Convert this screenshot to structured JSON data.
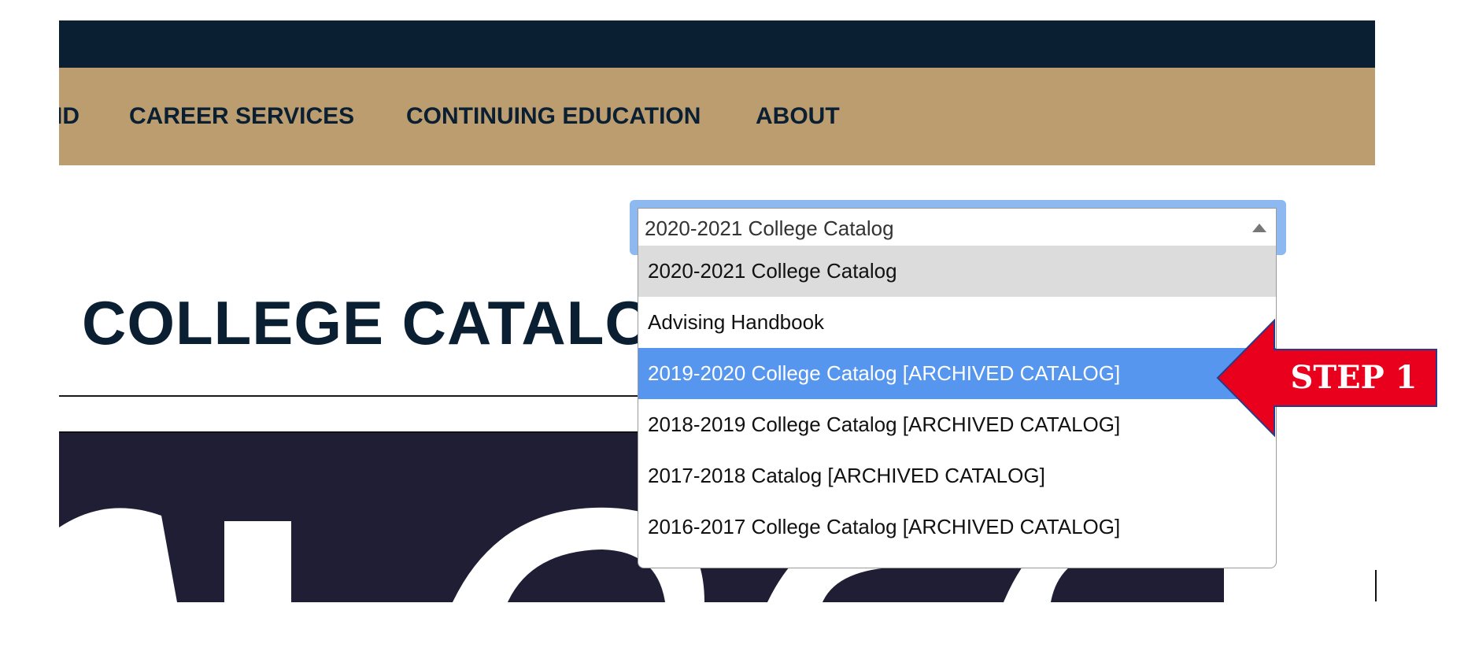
{
  "nav": {
    "items": [
      {
        "label": "ID"
      },
      {
        "label": "CAREER SERVICES"
      },
      {
        "label": "CONTINUING EDUCATION"
      },
      {
        "label": "ABOUT"
      }
    ]
  },
  "main": {
    "title": "COLLEGE CATALOG"
  },
  "catalog_select": {
    "selected": "2020-2021 College Catalog",
    "options": [
      {
        "label": "2020-2021 College Catalog",
        "state": "current"
      },
      {
        "label": "Advising Handbook",
        "state": "normal"
      },
      {
        "label": "2019-2020 College Catalog [ARCHIVED CATALOG]",
        "state": "highlighted"
      },
      {
        "label": "2018-2019 College Catalog [ARCHIVED CATALOG]",
        "state": "normal"
      },
      {
        "label": "2017-2018 Catalog [ARCHIVED CATALOG]",
        "state": "normal"
      },
      {
        "label": "2016-2017 College Catalog [ARCHIVED CATALOG]",
        "state": "normal"
      }
    ]
  },
  "annotation": {
    "label": "STEP 1"
  },
  "colors": {
    "navy": "#0b1f33",
    "gold": "#bc9d6f",
    "highlight": "#5696ee",
    "arrow": "#e8001c"
  }
}
